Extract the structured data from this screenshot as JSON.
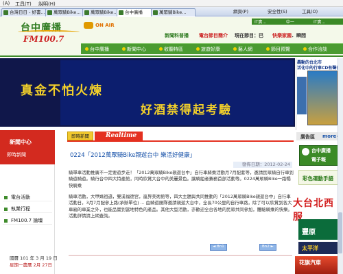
{
  "browser": {
    "menu": [
      "(A)",
      "工具(T)",
      "說明(H)"
    ],
    "tabs": [
      {
        "label": "台灣日日 - 好書..."
      },
      {
        "label": "萬眾騎Bike..."
      },
      {
        "label": "萬眾騎Bike..."
      },
      {
        "label": "台中廣播",
        "active": true
      },
      {
        "label": "萬眾騎Bike..."
      }
    ],
    "toolbar": [
      "網頁(P)",
      "安全性(S)",
      "工具(O)"
    ]
  },
  "site": {
    "logo_cn": "台中廣播",
    "logo_fm": "FM100.7",
    "onair": "ON AIR",
    "hlink1": "新聞科普播",
    "hlink2": "電台節目簡介",
    "hlink3": "現在節目：巴",
    "hlink4": "快樂家園",
    "hlink5": "．瞬間",
    "topstrip": [
      "IT廣...",
      "中一",
      "IT廣..."
    ],
    "nav": [
      "台中廣播",
      "新聞中心",
      "收聽特區",
      "旅遊好康",
      "藝人網",
      "節目預覽",
      "合作洽談"
    ]
  },
  "banner": {
    "line1": "真金不怕火煉",
    "line2": "好酒禁得起考驗"
  },
  "right_ad": {
    "line1": "轟動的台北市",
    "line2": "活化中的行車CD有聲書"
  },
  "left": {
    "news_title": "新聞中心",
    "news_sub": "即時新聞",
    "menu": [
      "電台活動",
      "執業行程",
      "FM100.7 論壇"
    ],
    "date1": "國曆 101 年 3 月 19 日",
    "date2": "星期一農曆 2月 27日"
  },
  "content": {
    "tab_news": "即時新聞",
    "tab_realtime": "Realtime",
    "title": "0224「2012萬眾騎Bike親遊台中 樂活好健康」",
    "date": "發佈日期：2012-02-24",
    "body1": "騎單車活動推廣不一定要遊步走！「2012萬眾騎Bike親遊台中」自行車騎乘活動月7月配套等，邀請民眾騎自行車到騎遊騎遊。騎行台中四大特產館，同時欣賞大台中的美麗景色。讓騎組者賽務首部活動等。0224萬眾騎Bike一路暢快騎乘",
    "body2": "騎車活動，大甲媽祖遶，雙溪福德宮，嵐界美術館等，四大主題與共同推動的「2012萬眾騎Bike親遊台中」自行車活動日，3月7月配參上路(承辦單位) ... 由騎遊團隊邀請親遊大台中，全長70公里的自行車路，除了可以欣賞到各大車廂的車業之外，也能品嘗到當地特色的產品。其他大型活動，亦歡迎全台各地的民眾共同參加，體驗騎乘的快樂。活動詳情請上網查詢。",
    "pager_prev": "◄ Bn1",
    "pager_next": "Bn2 ►"
  },
  "right": {
    "head_l": "廣告區",
    "head_r": "more+",
    "ad1_t1": "台中廣播",
    "ad1_t2": "電子報",
    "ad2": "彩色運動手語",
    "ad3": "大台北西服",
    "ad4": "豐原",
    "ad5": "太平洋",
    "ad6": "花旗汽車"
  },
  "colors": {
    "brand_green": "#3f8b2b",
    "accent_red": "#e43020",
    "banner_bg": "#10174a",
    "banner_text": "#f3d02a"
  }
}
